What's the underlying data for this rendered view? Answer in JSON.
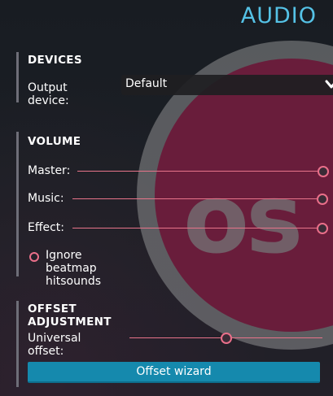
{
  "title": "AUDIO",
  "devices": {
    "heading": "DEVICES",
    "output_label": "Output device:",
    "output_value": "Default",
    "chevron_icon": "chevron-down-icon"
  },
  "volume": {
    "heading": "VOLUME",
    "sliders": [
      {
        "label": "Master:",
        "level": 1.0
      },
      {
        "label": "Music:",
        "level": 1.0
      },
      {
        "label": "Effect:",
        "level": 1.0
      }
    ],
    "ignore_hitsounds": {
      "label": "Ignore beatmap hitsounds",
      "checked": false
    }
  },
  "offset": {
    "heading": "OFFSET ADJUSTMENT",
    "universal_label": "Universal offset:",
    "universal_level": 0.5,
    "wizard_label": "Offset wizard"
  },
  "background": {
    "logo_text": "os"
  },
  "colors": {
    "accent_blue": "#55c2e6",
    "slider_pink": "#ea6f8a",
    "button_blue": "#1589ad",
    "logo_pink": "#8b2149"
  }
}
